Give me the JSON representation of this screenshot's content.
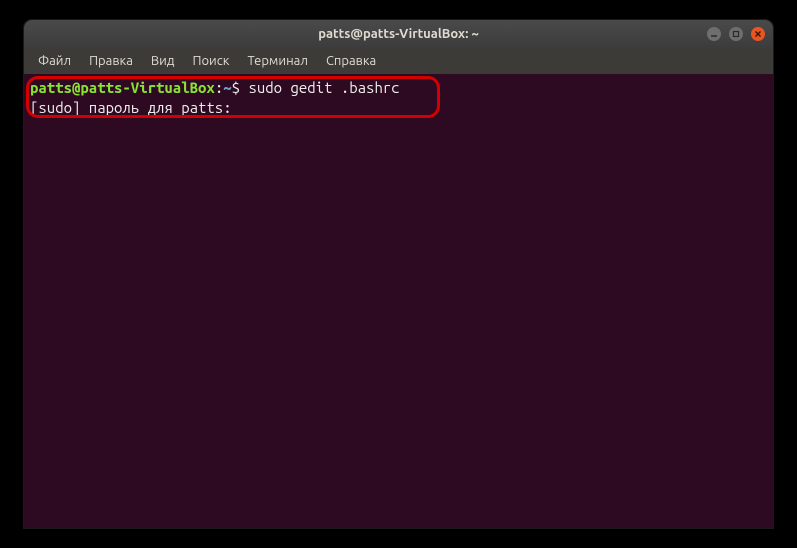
{
  "window": {
    "title": "patts@patts-VirtualBox: ~"
  },
  "menubar": {
    "items": [
      "Файл",
      "Правка",
      "Вид",
      "Поиск",
      "Терминал",
      "Справка"
    ]
  },
  "terminal": {
    "prompt_user_host": "patts@patts-VirtualBox",
    "prompt_colon": ":",
    "prompt_path": "~",
    "prompt_symbol": "$ ",
    "command": "sudo gedit .bashrc",
    "line2": "[sudo] пароль для patts: "
  }
}
